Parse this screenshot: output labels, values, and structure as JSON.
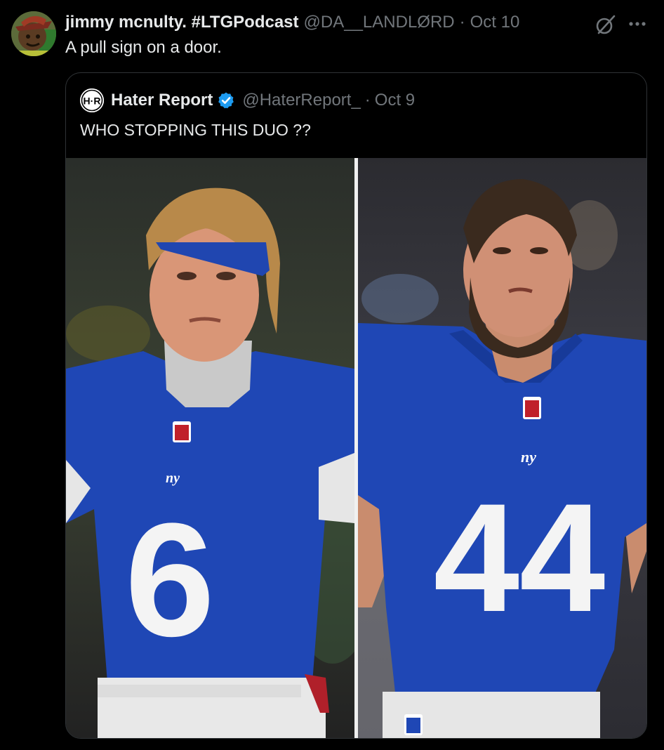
{
  "tweet": {
    "display_name": "jimmy mcnulty. #LTGPodcast",
    "handle": "@DA__LANDLØRD",
    "separator": "·",
    "date": "Oct 10",
    "text": "A pull sign on a door.",
    "icons": [
      "grok-icon",
      "more-icon"
    ]
  },
  "quoted_tweet": {
    "avatar_letters": "H·R",
    "display_name": "Hater Report",
    "verified": true,
    "handle": "@HaterReport_",
    "separator": "·",
    "date": "Oct 9",
    "text": "WHO STOPPING THIS DUO ??",
    "media": [
      {
        "jersey_number": "6",
        "team_mark": "ny",
        "badge": "NFL"
      },
      {
        "jersey_number": "44",
        "team_mark": "ny",
        "badge": "NFL"
      }
    ]
  },
  "colors": {
    "background": "#000000",
    "text_primary": "#e7e9ea",
    "text_secondary": "#71767b",
    "border": "#2f3336",
    "verified_blue": "#1d9bf0",
    "giants_blue": "#1f47b5"
  }
}
